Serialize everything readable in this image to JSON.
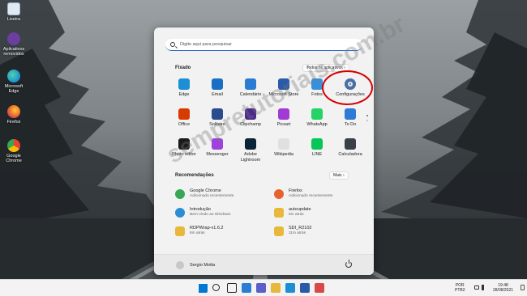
{
  "desktop_icons": [
    {
      "label": "Lixeira",
      "icon": "recycle-bin-icon",
      "color": "#dfe8f3"
    },
    {
      "label": "Aplicativos removidos",
      "icon": "removed-apps-icon",
      "color": "#6b3fa0"
    },
    {
      "label": "Microsoft Edge",
      "icon": "edge-icon",
      "color": "#1d8fd6"
    },
    {
      "label": "Firefox",
      "icon": "firefox-icon",
      "color": "#e8632c"
    },
    {
      "label": "Google Chrome",
      "icon": "chrome-icon",
      "color": "#34a853"
    }
  ],
  "start_menu": {
    "search_placeholder": "Digite aqui para pesquisar",
    "pinned_title": "Fixado",
    "all_apps_label": "Todos os aplicativos  ›",
    "pinned_apps": [
      {
        "label": "Edge",
        "icon": "edge-icon",
        "color": "#1d8fd6"
      },
      {
        "label": "Email",
        "icon": "mail-icon",
        "color": "#1a6fc4"
      },
      {
        "label": "Calendário",
        "icon": "calendar-icon",
        "color": "#2b7cd3"
      },
      {
        "label": "Microsoft Store",
        "icon": "store-icon",
        "color": "#2a5aa8"
      },
      {
        "label": "Fotos",
        "icon": "photos-icon",
        "color": "#3a8fd9"
      },
      {
        "label": "Configurações",
        "icon": "settings-gear-icon",
        "color": "#4a6fa5"
      },
      {
        "label": "Office",
        "icon": "office-icon",
        "color": "#d83b01"
      },
      {
        "label": "Solitaire",
        "icon": "solitaire-icon",
        "color": "#2a4b8d"
      },
      {
        "label": "Clipchamp",
        "icon": "clipchamp-icon",
        "color": "#4b2a8a"
      },
      {
        "label": "Picsart",
        "icon": "picsart-icon",
        "color": "#a23ad6"
      },
      {
        "label": "WhatsApp",
        "icon": "whatsapp-icon",
        "color": "#25d366"
      },
      {
        "label": "To Do",
        "icon": "todo-icon",
        "color": "#2e7ad6"
      },
      {
        "label": "Photo editor",
        "icon": "photo-editor-icon",
        "color": "#1a1a1a"
      },
      {
        "label": "Messenger",
        "icon": "messenger-icon",
        "color": "#a040e0"
      },
      {
        "label": "Adobe Lightroom",
        "icon": "lightroom-icon",
        "color": "#0b2438"
      },
      {
        "label": "Wikipedia",
        "icon": "wikipedia-icon",
        "color": "#e0e0e0"
      },
      {
        "label": "LINE",
        "icon": "line-icon",
        "color": "#06c755"
      },
      {
        "label": "Calculadora",
        "icon": "calculator-icon",
        "color": "#3a3f48"
      }
    ],
    "recommended_title": "Recomendações",
    "more_label": "Mais  ›",
    "recommended": [
      {
        "name": "Google Chrome",
        "sub": "Adicionado recentemente",
        "icon": "chrome-icon",
        "color": "#34a853"
      },
      {
        "name": "Firefox",
        "sub": "Adicionado recentemente",
        "icon": "firefox-icon",
        "color": "#e8632c"
      },
      {
        "name": "Introdução",
        "sub": "Bem-vindo ao Windows",
        "icon": "get-started-icon",
        "color": "#2b8cd6"
      },
      {
        "name": "autoupdate",
        "sub": "5m atrás",
        "icon": "folder-icon",
        "color": "#e8b83a"
      },
      {
        "name": "RDPWrap-v1.6.2",
        "sub": "6m atrás",
        "icon": "folder-icon",
        "color": "#e8b83a"
      },
      {
        "name": "SDI_R2102",
        "sub": "11m atrás",
        "icon": "folder-icon",
        "color": "#e8b83a"
      }
    ],
    "user_name": "Sergio Motta"
  },
  "watermark": "sempretutoriais.com.br",
  "taskbar": {
    "items": [
      {
        "icon": "windows-start-icon",
        "color": "#0078d4"
      },
      {
        "icon": "search-icon",
        "color": "#222222"
      },
      {
        "icon": "task-view-icon",
        "color": "#222222"
      },
      {
        "icon": "widgets-icon",
        "color": "#2b7cd3"
      },
      {
        "icon": "chat-icon",
        "color": "#5b5fc7"
      },
      {
        "icon": "file-explorer-icon",
        "color": "#e8b83a"
      },
      {
        "icon": "edge-icon",
        "color": "#1d8fd6"
      },
      {
        "icon": "store-icon",
        "color": "#2a5aa8"
      },
      {
        "icon": "snipping-icon",
        "color": "#d84a4a"
      }
    ],
    "lang_line1": "POR",
    "lang_line2": "PTB2",
    "time": "19:48",
    "date": "28/08/2021"
  }
}
